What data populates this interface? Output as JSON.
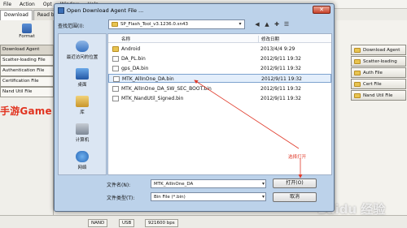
{
  "menubar": {
    "items": [
      "File",
      "Action",
      "Opt",
      "Window",
      "Help"
    ]
  },
  "tabs": [
    "Download",
    "Read ba"
  ],
  "left_panel": {
    "format_label": "Format",
    "rows": [
      "Download Agent",
      "Scatter-loading File",
      "Authentication File",
      "Certification File",
      "Nand Util File"
    ]
  },
  "brand": "手游Game",
  "right_panel": {
    "buttons": [
      "Download Agent",
      "Scatter-loading",
      "Auth File",
      "Cert File",
      "Nand Util File"
    ]
  },
  "status": {
    "cells": [
      "NAND",
      "USB",
      "921600 bps"
    ]
  },
  "watermark": "Baidu 经验",
  "dialog": {
    "title": "Open Download Agent File ...",
    "lookin_label": "查找范围(I):",
    "lookin_value": "SP_Flash_Tool_v3.1236.0.sn43",
    "places": [
      "最近访问的位置",
      "桌面",
      "库",
      "计算机",
      "网络"
    ],
    "columns": {
      "name": "名称",
      "date": "修改日期"
    },
    "files": [
      {
        "name": "Android",
        "date": "2013/4/4 9:29",
        "type": "folder"
      },
      {
        "name": "DA_PL.bin",
        "date": "2012/9/11 19:32",
        "type": "file"
      },
      {
        "name": "gps_DA.bin",
        "date": "2012/9/11 19:32",
        "type": "file"
      },
      {
        "name": "MTK_AllInOne_DA.bin",
        "date": "2012/9/11 19:32",
        "type": "file",
        "selected": true
      },
      {
        "name": "MTK_AllInOne_DA_SW_SEC_BOOT.bin",
        "date": "2012/9/11 19:32",
        "type": "file"
      },
      {
        "name": "MTK_NandUtil_Signed.bin",
        "date": "2012/9/11 19:32",
        "type": "file"
      }
    ],
    "annotation": "选择打开",
    "filename_label": "文件名(N):",
    "filename_value": "MTK_AllInOne_DA",
    "filetype_label": "文件类型(T):",
    "filetype_value": "Bin File (*.bin)",
    "open_label": "打开(O)",
    "cancel_label": "取消"
  },
  "colors": {
    "accent_red": "#e03a2a",
    "dialog_frame": "#bcd2ea",
    "selection": "#e3eefb"
  }
}
